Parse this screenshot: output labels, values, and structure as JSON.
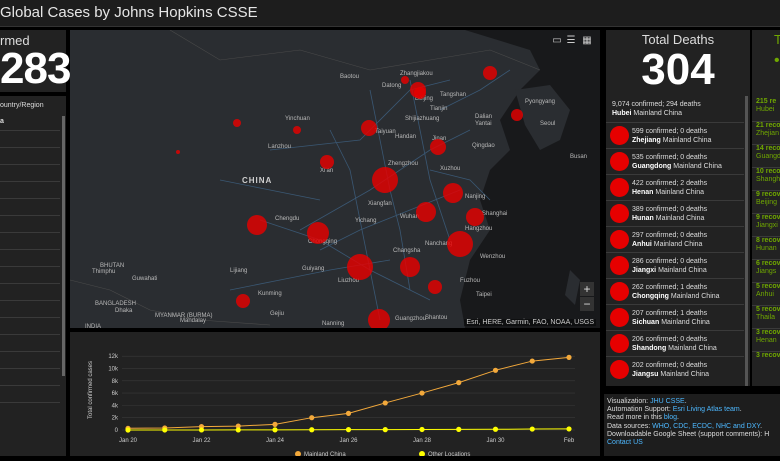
{
  "header": {
    "title": "Global Cases by Johns Hopkins CSSE"
  },
  "confirmed": {
    "label": "rmed",
    "value": "283"
  },
  "by_country": {
    "label": "ountry/Region",
    "sub": "a"
  },
  "map": {
    "country_label": "CHINA",
    "cities": [
      "Baotou",
      "Zhangjiakou",
      "Datong",
      "Beijing",
      "Yinchuan",
      "Taiyuan",
      "Shijiazhuang",
      "Tianjin",
      "Tangshan",
      "Dalian",
      "Pyongyang",
      "Seoul",
      "Busan",
      "Yantai",
      "Qingdao",
      "Lanzhou",
      "Handan",
      "Jinan",
      "Xi'an",
      "Zhengzhou",
      "Xuzhou",
      "Xiangfan",
      "Nanjing",
      "Chengdu",
      "Yichang",
      "Wuhan",
      "Shanghai",
      "Chongqing",
      "Hangzhou",
      "Changsha",
      "Nanchang",
      "Guiyang",
      "Wenzhou",
      "Fuzhou",
      "Kunming",
      "Taipei",
      "Liuzhou",
      "Nanning",
      "Guangzhou",
      "Shantou",
      "Lijiang",
      "Thimphu",
      "Guwahati",
      "Dhaka",
      "Gejiu",
      "Mandalay"
    ],
    "region_labels": [
      "BANGLADESH",
      "MYANMAR (BURMA)",
      "BHUTAN",
      "INDIA"
    ],
    "attribution": "Esri, HERE, Garmin, FAO, NOAA, USGS",
    "zoom_in": "+",
    "zoom_out": "−",
    "circle_color": "#e60000"
  },
  "chart_data": {
    "type": "line",
    "xlabel": "",
    "ylabel": "Total confirmed cases",
    "x": [
      "Jan 20",
      "Jan 21",
      "Jan 22",
      "Jan 23",
      "Jan 24",
      "Jan 25",
      "Jan 26",
      "Jan 27",
      "Jan 28",
      "Jan 29",
      "Jan 30",
      "Jan 31",
      "Feb 1"
    ],
    "x_ticks": [
      "Jan 20",
      "Jan 22",
      "Jan 24",
      "Jan 26",
      "Jan 28",
      "Jan 30",
      "Feb"
    ],
    "y_ticks": [
      "0",
      "2k",
      "4k",
      "6k",
      "8k",
      "10k",
      "12k"
    ],
    "ylim": [
      0,
      13000
    ],
    "series": [
      {
        "name": "Mainland China",
        "color": "#f3a93b",
        "values": [
          278,
          326,
          547,
          639,
          916,
          2000,
          2700,
          4400,
          6000,
          7700,
          9700,
          11200,
          11800
        ]
      },
      {
        "name": "Other Locations",
        "color": "#ffff00",
        "values": [
          4,
          6,
          8,
          14,
          25,
          40,
          57,
          64,
          87,
          105,
          118,
          153,
          173
        ]
      }
    ],
    "grid": true,
    "legend": "bottom"
  },
  "deaths": {
    "label": "Total Deaths",
    "value": "304",
    "items": [
      {
        "stats": "9,074 confirmed; 294 deaths",
        "place": "Hubei",
        "region": "Mainland China"
      },
      {
        "stats": "599 confirmed; 0 deaths",
        "place": "Zhejiang",
        "region": "Mainland China"
      },
      {
        "stats": "535 confirmed; 0 deaths",
        "place": "Guangdong",
        "region": "Mainland China"
      },
      {
        "stats": "422 confirmed; 2 deaths",
        "place": "Henan",
        "region": "Mainland China"
      },
      {
        "stats": "389 confirmed; 0 deaths",
        "place": "Hunan",
        "region": "Mainland China"
      },
      {
        "stats": "297 confirmed; 0 deaths",
        "place": "Anhui",
        "region": "Mainland China"
      },
      {
        "stats": "286 confirmed; 0 deaths",
        "place": "Jiangxi",
        "region": "Mainland China"
      },
      {
        "stats": "262 confirmed; 1 deaths",
        "place": "Chongqing",
        "region": "Mainland China"
      },
      {
        "stats": "207 confirmed; 1 deaths",
        "place": "Sichuan",
        "region": "Mainland China"
      },
      {
        "stats": "206 confirmed; 0 deaths",
        "place": "Shandong",
        "region": "Mainland China"
      },
      {
        "stats": "202 confirmed; 0 deaths",
        "place": "Jiangsu",
        "region": "Mainland China"
      }
    ]
  },
  "recovered": {
    "label": "T",
    "items": [
      {
        "count": "215 re",
        "place": "Hubei"
      },
      {
        "count": "21 reco",
        "place": "Zhejian"
      },
      {
        "count": "14 reco",
        "place": "Guangdo"
      },
      {
        "count": "10 reco",
        "place": "Shangh"
      },
      {
        "count": "9 recov",
        "place": "Beijing"
      },
      {
        "count": "9 recov",
        "place": "Jiangxi"
      },
      {
        "count": "8 recov",
        "place": "Hunan"
      },
      {
        "count": "6 recov",
        "place": "Jiangs"
      },
      {
        "count": "5 recov",
        "place": "Anhui"
      },
      {
        "count": "5 recov",
        "place": "Thaila"
      },
      {
        "count": "3 recov",
        "place": "Henan"
      },
      {
        "count": "3 recov",
        "place": ""
      }
    ]
  },
  "info": {
    "vis_label": "Visualization: ",
    "vis_link": "JHU CSSE",
    "auto_label": "Automation Support: ",
    "auto_link": "Esri Living Atlas team",
    "read_label": "Read more in this ",
    "read_link": "blog",
    "src_label": "Data sources: ",
    "src_links": "WHO, CDC, ECDC, NHC and DXY",
    "sheet_label": "Downloadable Google Sheet (support comments): H",
    "contact_link": "Contact US"
  }
}
